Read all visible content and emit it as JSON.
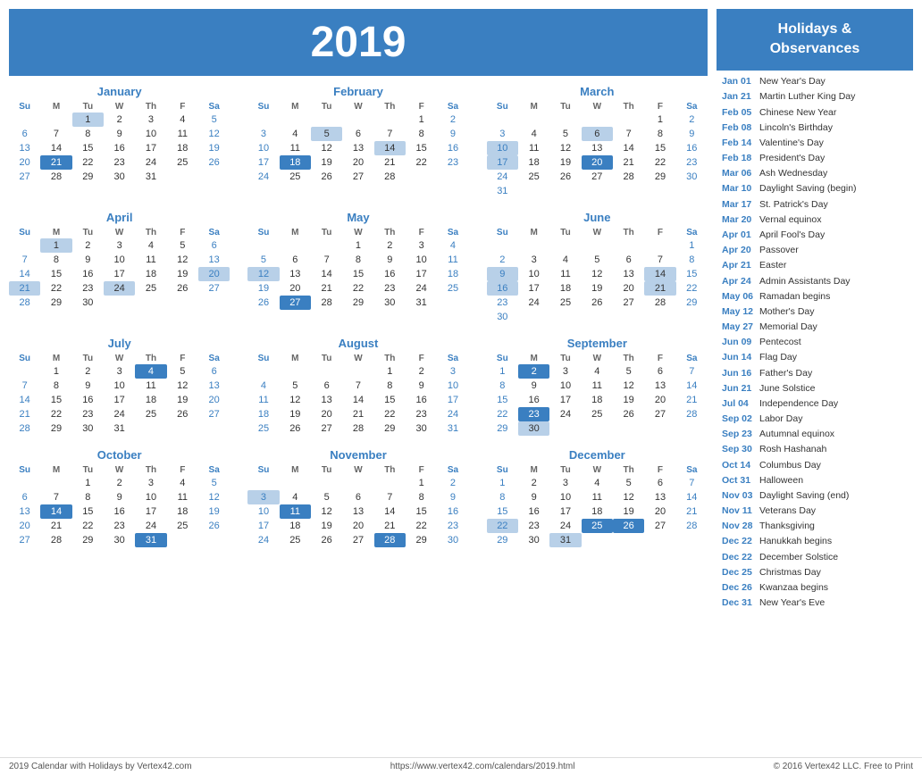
{
  "year": "2019",
  "months": [
    {
      "name": "January",
      "startDay": 2,
      "days": 31,
      "highlights": [
        1
      ],
      "darkHighlights": [
        21
      ]
    },
    {
      "name": "February",
      "startDay": 5,
      "days": 28,
      "highlights": [
        5,
        14,
        18
      ],
      "darkHighlights": [
        18
      ]
    },
    {
      "name": "March",
      "startDay": 5,
      "days": 31,
      "highlights": [
        6,
        10,
        17,
        20
      ],
      "darkHighlights": [
        20
      ]
    },
    {
      "name": "April",
      "startDay": 1,
      "days": 30,
      "highlights": [
        1,
        20,
        21,
        24
      ],
      "darkHighlights": []
    },
    {
      "name": "May",
      "startDay": 3,
      "days": 31,
      "highlights": [
        12,
        27
      ],
      "darkHighlights": [
        27
      ]
    },
    {
      "name": "June",
      "startDay": 6,
      "days": 30,
      "highlights": [
        9,
        14,
        16,
        21
      ],
      "darkHighlights": []
    },
    {
      "name": "July",
      "startDay": 1,
      "days": 31,
      "highlights": [
        4
      ],
      "darkHighlights": [
        4
      ]
    },
    {
      "name": "August",
      "startDay": 4,
      "days": 31,
      "highlights": [],
      "darkHighlights": []
    },
    {
      "name": "September",
      "startDay": 0,
      "days": 30,
      "highlights": [
        2,
        23,
        30
      ],
      "darkHighlights": [
        2,
        23
      ]
    },
    {
      "name": "October",
      "startDay": 2,
      "days": 31,
      "highlights": [
        14,
        31
      ],
      "darkHighlights": [
        14,
        31
      ]
    },
    {
      "name": "November",
      "startDay": 5,
      "days": 30,
      "highlights": [
        3,
        11,
        28
      ],
      "darkHighlights": [
        11,
        28
      ]
    },
    {
      "name": "December",
      "startDay": 0,
      "days": 31,
      "highlights": [
        22,
        25,
        26,
        31
      ],
      "darkHighlights": [
        25,
        26
      ]
    }
  ],
  "sidebar": {
    "title": "Holidays &\nObservances",
    "holidays": [
      {
        "date": "Jan 01",
        "name": "New Year's Day"
      },
      {
        "date": "Jan 21",
        "name": "Martin Luther King Day"
      },
      {
        "date": "Feb 05",
        "name": "Chinese New Year"
      },
      {
        "date": "Feb 08",
        "name": "Lincoln's Birthday"
      },
      {
        "date": "Feb 14",
        "name": "Valentine's Day"
      },
      {
        "date": "Feb 18",
        "name": "President's Day"
      },
      {
        "date": "Mar 06",
        "name": "Ash Wednesday"
      },
      {
        "date": "Mar 10",
        "name": "Daylight Saving (begin)"
      },
      {
        "date": "Mar 17",
        "name": "St. Patrick's Day"
      },
      {
        "date": "Mar 20",
        "name": "Vernal equinox"
      },
      {
        "date": "Apr 01",
        "name": "April Fool's Day"
      },
      {
        "date": "Apr 20",
        "name": "Passover"
      },
      {
        "date": "Apr 21",
        "name": "Easter"
      },
      {
        "date": "Apr 24",
        "name": "Admin Assistants Day"
      },
      {
        "date": "May 06",
        "name": "Ramadan begins"
      },
      {
        "date": "May 12",
        "name": "Mother's Day"
      },
      {
        "date": "May 27",
        "name": "Memorial Day"
      },
      {
        "date": "Jun 09",
        "name": "Pentecost"
      },
      {
        "date": "Jun 14",
        "name": "Flag Day"
      },
      {
        "date": "Jun 16",
        "name": "Father's Day"
      },
      {
        "date": "Jun 21",
        "name": "June Solstice"
      },
      {
        "date": "Jul 04",
        "name": "Independence Day"
      },
      {
        "date": "Sep 02",
        "name": "Labor Day"
      },
      {
        "date": "Sep 23",
        "name": "Autumnal equinox"
      },
      {
        "date": "Sep 30",
        "name": "Rosh Hashanah"
      },
      {
        "date": "Oct 14",
        "name": "Columbus Day"
      },
      {
        "date": "Oct 31",
        "name": "Halloween"
      },
      {
        "date": "Nov 03",
        "name": "Daylight Saving (end)"
      },
      {
        "date": "Nov 11",
        "name": "Veterans Day"
      },
      {
        "date": "Nov 28",
        "name": "Thanksgiving"
      },
      {
        "date": "Dec 22",
        "name": "Hanukkah begins"
      },
      {
        "date": "Dec 22",
        "name": "December Solstice"
      },
      {
        "date": "Dec 25",
        "name": "Christmas Day"
      },
      {
        "date": "Dec 26",
        "name": "Kwanzaa begins"
      },
      {
        "date": "Dec 31",
        "name": "New Year's Eve"
      }
    ]
  },
  "footer": {
    "left": "2019 Calendar with Holidays by Vertex42.com",
    "center": "https://www.vertex42.com/calendars/2019.html",
    "right": "© 2016 Vertex42 LLC. Free to Print"
  }
}
